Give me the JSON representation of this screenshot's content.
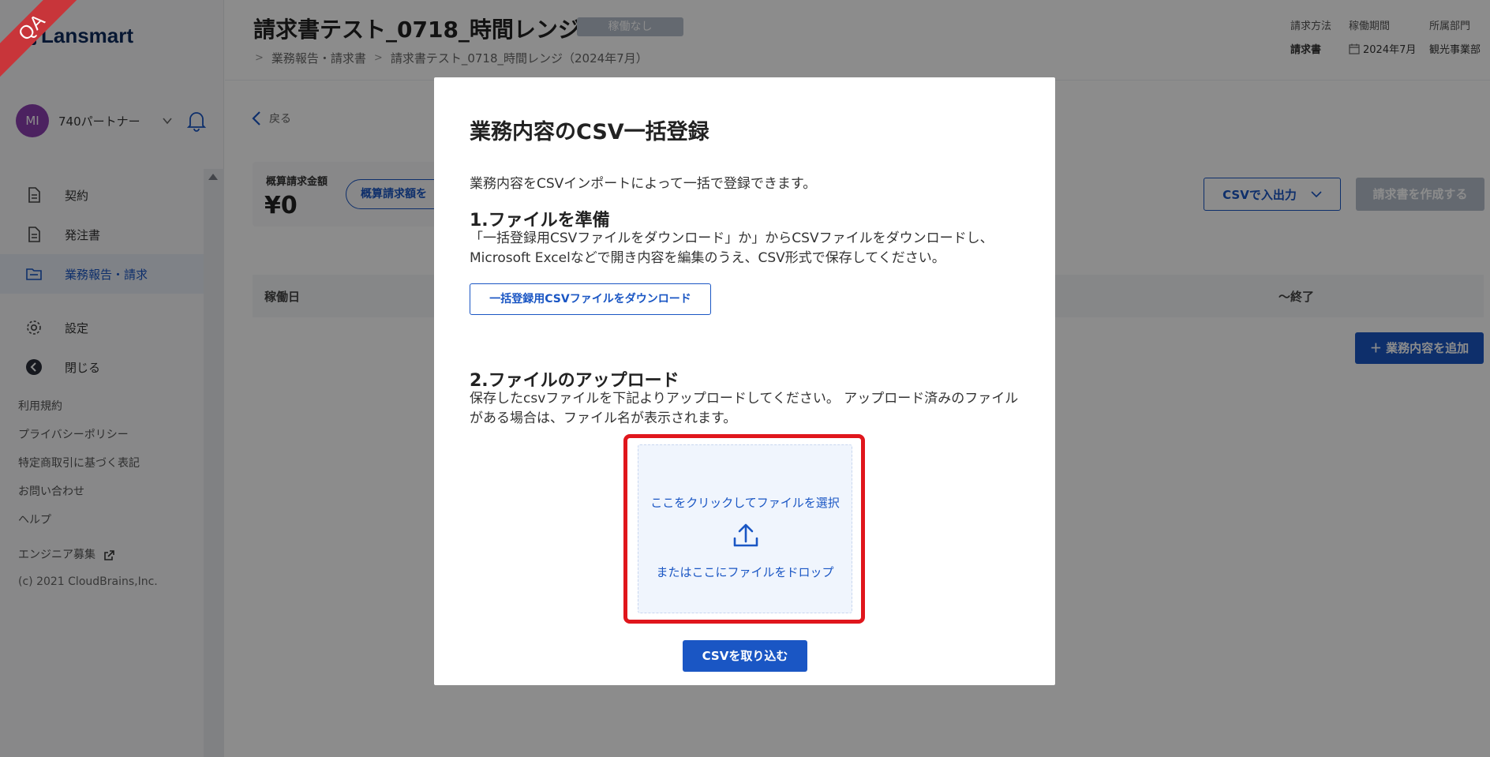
{
  "ribbon": "QA",
  "brand": "Lansmart",
  "user": {
    "initials": "MI",
    "name": "740パートナー"
  },
  "nav": [
    {
      "label": "契約"
    },
    {
      "label": "発注書"
    },
    {
      "label": "業務報告・請求"
    },
    {
      "label": "設定"
    },
    {
      "label": "閉じる"
    }
  ],
  "footer_links": [
    "利用規約",
    "プライバシーポリシー",
    "特定商取引に基づく表記",
    "お問い合わせ",
    "ヘルプ",
    "エンジニア募集"
  ],
  "copyright": "(c) 2021 CloudBrains,Inc.",
  "header": {
    "title": "請求書テスト_0718_時間レンジ",
    "status": "稼働なし",
    "breadcrumb": [
      "業務報告・請求書",
      "請求書テスト_0718_時間レンジ（2024年7月）"
    ],
    "meta": [
      {
        "label": "請求方法",
        "value": "請求書"
      },
      {
        "label": "稼働期間",
        "value": "2024年7月"
      },
      {
        "label": "所属部門",
        "value": "観光事業部"
      }
    ]
  },
  "back_label": "戻る",
  "summary": {
    "label": "概算請求金額",
    "value": "¥0",
    "button": "概算請求額を"
  },
  "toolbar": {
    "csv_io": "CSVで入出力",
    "create": "請求書を作成する"
  },
  "table": {
    "col1": "稼働日",
    "col2": "～終了"
  },
  "add_button": "＋ 業務内容を追加",
  "modal": {
    "title": "業務内容のCSV一括登録",
    "description": "業務内容をCSVインポートによって一括で登録できます。",
    "step1_title": "1.ファイルを準備",
    "step1_text": "「一括登録用CSVファイルをダウンロード」か」からCSVファイルをダウンロードし、Microsoft Excelなどで開き内容を編集のうえ、CSV形式で保存してください。",
    "download_button": "一括登録用CSVファイルをダウンロード",
    "step2_title": "2.ファイルのアップロード",
    "step2_text": "保存したcsvファイルを下記よりアップロードしてください。 アップロード済みのファイルがある場合は、ファイル名が表示されます。",
    "dropzone_click": "ここをクリックしてファイルを選択",
    "dropzone_drop": "またはここにファイルをドロップ",
    "import_button": "CSVを取り込む"
  },
  "colors": {
    "primary": "#1a56c4",
    "highlight": "#e0161c",
    "avatar": "#8b3fb0",
    "badge": "#b6bfcc"
  }
}
